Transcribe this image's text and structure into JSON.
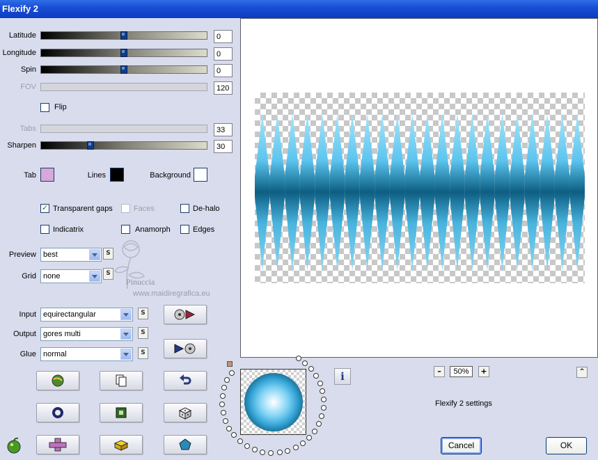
{
  "window": {
    "title": "Flexify 2"
  },
  "sliders": [
    {
      "label": "Latitude",
      "value": "0",
      "level": 0.5,
      "enabled": true
    },
    {
      "label": "Longitude",
      "value": "0",
      "level": 0.5,
      "enabled": true
    },
    {
      "label": "Spin",
      "value": "0",
      "level": 0.5,
      "enabled": true
    },
    {
      "label": "FOV",
      "value": "120",
      "enabled": false
    },
    {
      "label": "Tabs",
      "value": "33",
      "enabled": false
    },
    {
      "label": "Sharpen",
      "value": "30",
      "level": 0.3,
      "enabled": true
    }
  ],
  "flip": {
    "label": "Flip",
    "checked": false
  },
  "colors": {
    "tab_label": "Tab",
    "tab_color": "#d8a8d8",
    "lines_label": "Lines",
    "lines_color": "#000000",
    "background_label": "Background",
    "background_color": "#ffffff"
  },
  "options": {
    "transparent_gaps": "Transparent gaps",
    "faces": "Faces",
    "de_halo": "De-halo",
    "indicatrix": "Indicatrix",
    "anamorph": "Anamorph",
    "edges": "Edges"
  },
  "dropdowns": {
    "preview_label": "Preview",
    "preview_value": "best",
    "grid_label": "Grid",
    "grid_value": "none",
    "input_label": "Input",
    "input_value": "equirectangular",
    "output_label": "Output",
    "output_value": "gores multi",
    "glue_label": "Glue",
    "glue_value": "normal",
    "s_label": "S"
  },
  "watermark": {
    "name": "Pinuccia",
    "url": "www.maidiregrafica.eu"
  },
  "zoom": {
    "value": "50%",
    "minus": "–",
    "plus": "+"
  },
  "settings_label": "Flexify 2 settings",
  "buttons": {
    "cancel": "Cancel",
    "ok": "OK",
    "info": "i",
    "up": "^"
  }
}
